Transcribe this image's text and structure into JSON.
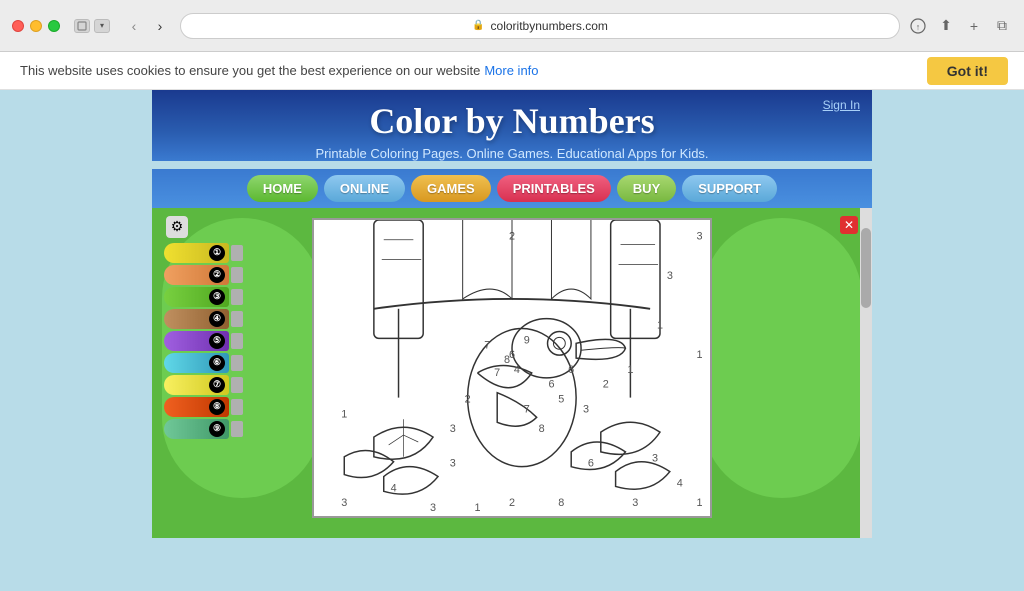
{
  "browser": {
    "url": "coloritbynumbers.com",
    "back_btn": "‹",
    "forward_btn": "›"
  },
  "cookie_banner": {
    "text": "This website uses cookies to ensure you get the best experience on our website",
    "more_info": "More info",
    "got_it": "Got it!"
  },
  "site": {
    "title": "Color by Numbers",
    "subtitle": "Printable Coloring Pages. Online Games. Educational Apps for Kids.",
    "sign_in": "Sign In",
    "nav": {
      "home": "HOME",
      "online": "ONLINE",
      "games": "GAMES",
      "printables": "PRINTABLES",
      "buy": "BUY",
      "support": "SUPPORT"
    }
  },
  "paint_tubes": [
    {
      "number": "①",
      "color": "#f0e860"
    },
    {
      "number": "②",
      "color": "#f0a060"
    },
    {
      "number": "③",
      "color": "#a0d060"
    },
    {
      "number": "④",
      "color": "#c08040"
    },
    {
      "number": "⑤",
      "color": "#9050d0"
    },
    {
      "number": "⑥",
      "color": "#50c0d0"
    },
    {
      "number": "⑦",
      "color": "#f0f060"
    },
    {
      "number": "⑧",
      "color": "#f06020"
    },
    {
      "number": "⑨",
      "color": "#80c0a0"
    }
  ]
}
